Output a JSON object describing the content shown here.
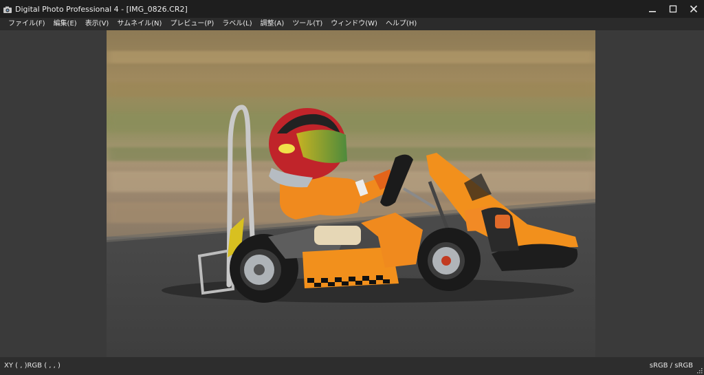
{
  "window": {
    "title": "Digital Photo Professional 4 - [IMG_0826.CR2]",
    "app_icon": "camera-app-icon",
    "controls": [
      "minimize-icon",
      "maximize-icon",
      "close-icon"
    ]
  },
  "menubar": {
    "items": [
      {
        "label": "ファイル(F)"
      },
      {
        "label": "編集(E)"
      },
      {
        "label": "表示(V)"
      },
      {
        "label": "サムネイル(N)"
      },
      {
        "label": "プレビュー(P)"
      },
      {
        "label": "ラベル(L)"
      },
      {
        "label": "調整(A)"
      },
      {
        "label": "ツール(T)"
      },
      {
        "label": "ウィンドウ(W)"
      },
      {
        "label": "ヘルプ(H)"
      }
    ]
  },
  "viewer": {
    "image_name": "IMG_0826.CR2"
  },
  "statusbar": {
    "xy_rgb": "XY (    ,     )RGB (    ,    ,    )",
    "color_space": "sRGB / sRGB"
  },
  "colors": {
    "titlebar_bg": "#1e1e1e",
    "menubar_bg": "#2b2b2b",
    "workspace_bg": "#3a3a3a",
    "kart_orange": "#f2901c"
  }
}
